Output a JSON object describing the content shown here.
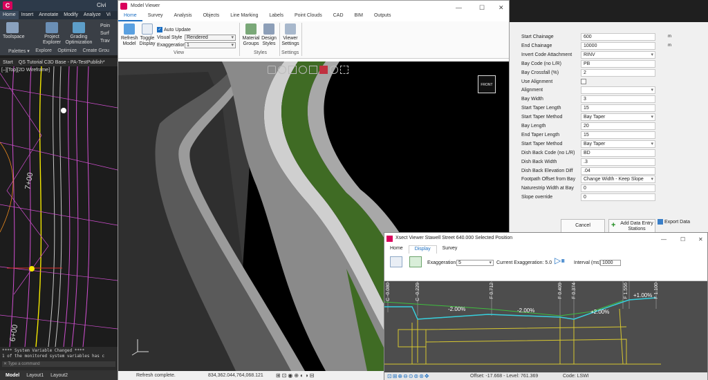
{
  "civil3d": {
    "tabs": [
      "Home",
      "Insert",
      "Annotate",
      "Modify",
      "Analyze",
      "Vi"
    ],
    "ribbon": {
      "toolspace": "Toolspace",
      "project_explorer": "Project Explorer",
      "grading_optimization": "Grading Optimization",
      "palettes": "Palettes ▾",
      "explore": "Explore",
      "optimize": "Optimize",
      "create_group": "Create Grou",
      "poin": "Poin",
      "surf": "Surf",
      "trav": "Trav"
    },
    "file_tabs": [
      "Start",
      "QS Tutorial C3D Base - PA-TestPublish*"
    ],
    "view_label": "[–][Top][2D Wireframe]",
    "station_labels": [
      "7+00",
      "6+00"
    ],
    "command_history": [
      "**** System Variable Changed ****",
      "1 of the monitored system variables has c"
    ],
    "command_placeholder": "Type a command",
    "layout_tabs": [
      "Model",
      "Layout1",
      "Layout2"
    ],
    "title_partial": "Civi"
  },
  "model_viewer": {
    "title": "Model Viewer",
    "tabs": [
      "Home",
      "Survey",
      "Analysis",
      "Objects",
      "Line Marking",
      "Labels",
      "Point Clouds",
      "CAD",
      "BIM",
      "Outputs"
    ],
    "ribbon": {
      "refresh_model": "Refresh Model",
      "toggle_display": "Toggle Display",
      "auto_update": "Auto Update",
      "visual_style_label": "Visual Style",
      "visual_style_value": "Rendered",
      "exaggeration_label": "Exaggeration",
      "exaggeration_value": "1",
      "view_group": "View",
      "material_groups": "Material Groups",
      "design_styles": "Design Styles",
      "styles_group": "Styles",
      "viewer_settings": "Viewer Settings",
      "settings_group": "Settings"
    },
    "cube_label": "FRONT",
    "status": {
      "message": "Refresh complete.",
      "coords": "834,362.044,764,068.121"
    }
  },
  "parameters": {
    "rows": [
      {
        "label": "Start Chainage",
        "value": "600",
        "unit": "m",
        "dd": false
      },
      {
        "label": "End Chainage",
        "value": "10000",
        "unit": "m",
        "dd": false
      },
      {
        "label": "Invert Code Attachment",
        "value": "RINV",
        "dd": true
      },
      {
        "label": "Bay Code (no L/R)",
        "value": "PB",
        "dd": false
      },
      {
        "label": "Bay Crossfall (%)",
        "value": "2",
        "dd": false
      },
      {
        "label": "Use Alignment",
        "value": "",
        "dd": false,
        "checkbox": true
      },
      {
        "label": "Alignment",
        "value": "",
        "dd": true
      },
      {
        "label": "Bay Width",
        "value": "3",
        "dd": false
      },
      {
        "label": "Start Taper Length",
        "value": "15",
        "dd": false
      },
      {
        "label": "Start Taper Method",
        "value": "Bay Taper",
        "dd": true
      },
      {
        "label": "Bay Length",
        "value": "20",
        "dd": false
      },
      {
        "label": "End Taper Length",
        "value": "15",
        "dd": false
      },
      {
        "label": "Start Taper Method",
        "value": "Bay Taper",
        "dd": true
      },
      {
        "label": "Dish Back Code (no L/R)",
        "value": "BD",
        "dd": false
      },
      {
        "label": "Dish Back Width",
        "value": ".3",
        "dd": false
      },
      {
        "label": "Dish Back Elevation Diff",
        "value": ".04",
        "dd": false
      },
      {
        "label": "Footpath Offset from Bay",
        "value": "Change Width - Keep Slope",
        "dd": true
      },
      {
        "label": "Naturestrip Width at Bay",
        "value": "0",
        "dd": false
      },
      {
        "label": "Slope override",
        "value": "0",
        "dd": false
      }
    ],
    "cancel": "Cancel",
    "add_data": "Add Data Entry Stations",
    "export_data": "Export Data"
  },
  "xsect": {
    "title": "Xsect Viewer Stawell Street  640.000 Selected Position",
    "tabs": [
      "Home",
      "Display",
      "Survey"
    ],
    "exaggeration_label": "Exaggeration:",
    "exaggeration_value": "5",
    "current_exaggeration": "Current Exaggeration: 5.0",
    "interval_label": "Interval (ms):",
    "interval_value": "1000",
    "vertical_labels": [
      "C -0.080",
      "C -0.229",
      "F 0.712",
      "F 0.409",
      "F 0.374",
      "F 1.556",
      "F 1.100"
    ],
    "grade_labels": [
      "-2.00%",
      "-2.00%",
      "+2.00%",
      "+1.00%"
    ],
    "status": {
      "offset": "Offset: -17.668 - Level: 761.369",
      "code": "Code: LSWI"
    }
  }
}
